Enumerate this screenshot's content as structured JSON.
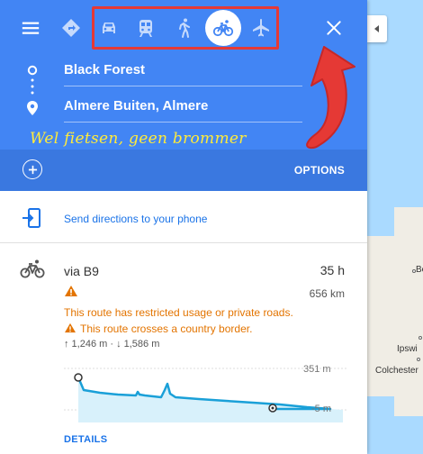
{
  "travel_modes": [
    {
      "name": "best-route",
      "active": false
    },
    {
      "name": "driving",
      "active": false
    },
    {
      "name": "transit",
      "active": false
    },
    {
      "name": "walking",
      "active": false
    },
    {
      "name": "cycling",
      "active": true
    },
    {
      "name": "flights",
      "active": false
    }
  ],
  "route": {
    "origin": "Black Forest",
    "destination": "Almere Buiten, Almere"
  },
  "annotation": {
    "text": "Wel fietsen, geen brommer"
  },
  "options": {
    "label": "OPTIONS"
  },
  "send": {
    "label": "Send directions to your phone"
  },
  "result": {
    "via": "via B9",
    "duration": "35 h",
    "distance": "656 km",
    "warning_restricted": "This route has restricted usage or private roads.",
    "warning_border": "This route crosses a country border.",
    "elevation": "↑ 1,246 m · ↓ 1,586 m",
    "elevation_max": "351 m",
    "elevation_min": "-5 m",
    "details_label": "DETAILS"
  },
  "map": {
    "places": [
      "Ipswi",
      "Colchester",
      "Be"
    ]
  },
  "colors": {
    "header_blue": "#4285f4",
    "options_bar": "#3a78e0",
    "warning": "#e37400",
    "link": "#1a73e8",
    "annotation_red": "#e53935",
    "annotation_yellow": "#ffeb3b",
    "elevation_line": "#1aa0d8"
  }
}
